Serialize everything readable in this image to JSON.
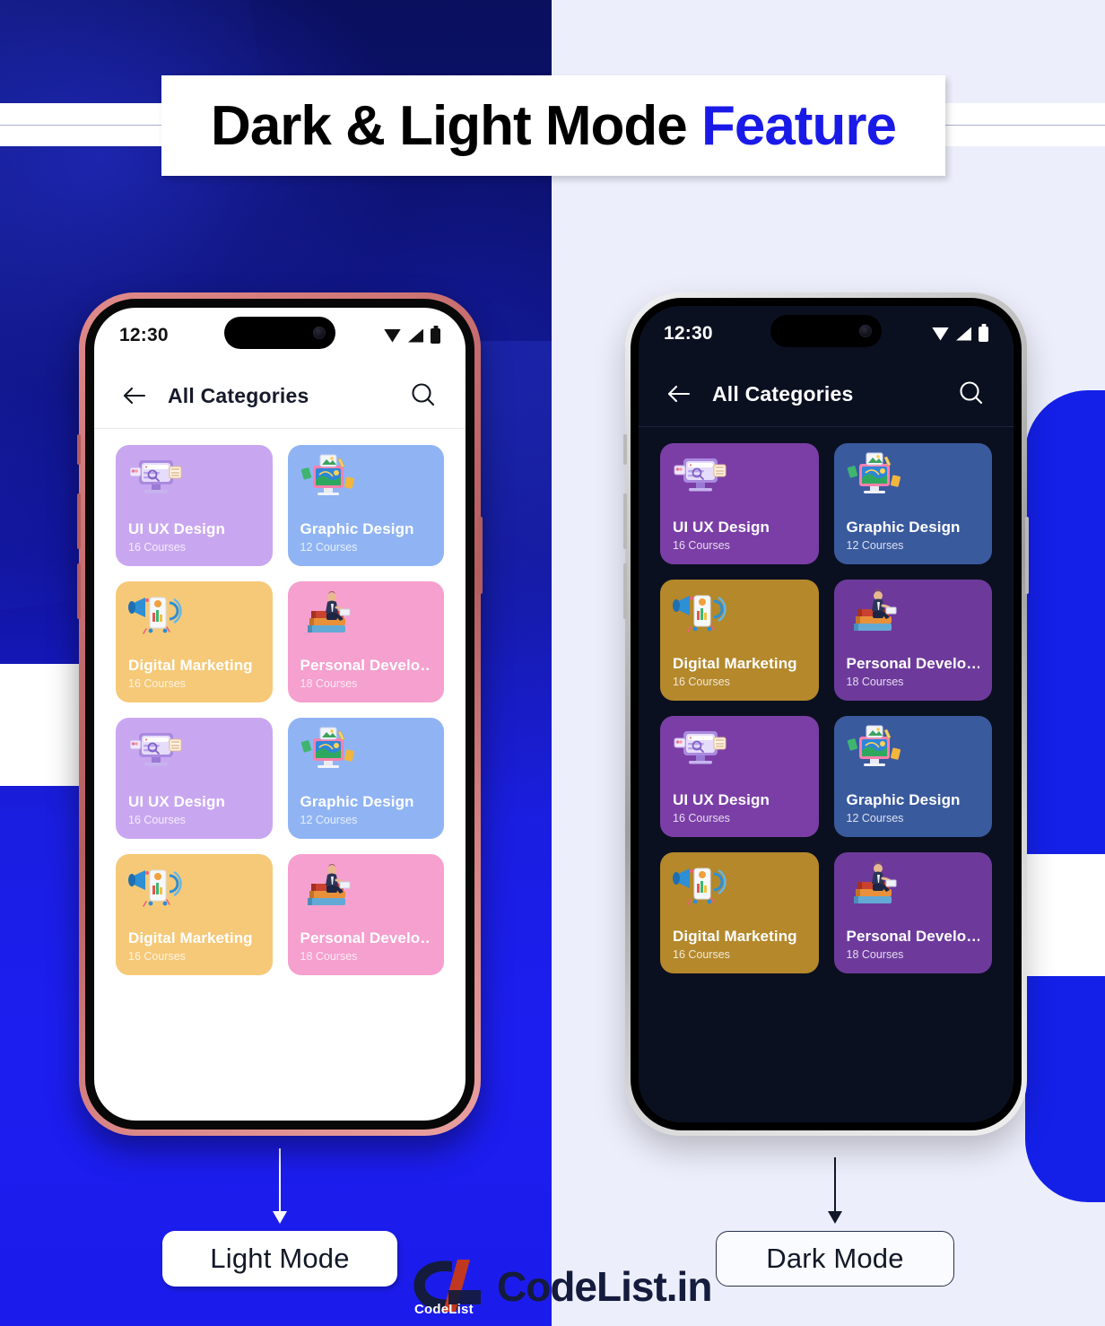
{
  "header": {
    "title_main": "Dark & Light Mode",
    "title_accent": "Feature"
  },
  "callouts": {
    "light_label": "Light Mode",
    "dark_label": "Dark Mode"
  },
  "watermark": {
    "brand": "CodeList.in",
    "logo_caption": "CodeList"
  },
  "colors": {
    "accent_blue": "#1a1ae8",
    "panel_blue": "#1420e8",
    "left_bg": "#10139a",
    "right_bg": "#eceefb",
    "light_screen_bg": "#ffffff",
    "dark_screen_bg": "#0b1020"
  },
  "light_phone": {
    "theme": "light",
    "status": {
      "time": "12:30",
      "icons": [
        "wifi-icon",
        "signal-icon",
        "battery-icon"
      ]
    },
    "appbar": {
      "back_icon": "back-arrow-icon",
      "title": "All Categories",
      "search_icon": "search-icon"
    },
    "cards": [
      {
        "title": "UI UX Design",
        "subtitle": "16 Courses",
        "color": "#c9a7f0",
        "illus": "ui-ux-monitor-illustration"
      },
      {
        "title": "Graphic Design",
        "subtitle": "12 Courses",
        "color": "#90b4f3",
        "illus": "graphic-design-monitor-illustration"
      },
      {
        "title": "Digital Marketing",
        "subtitle": "16 Courses",
        "color": "#f6c978",
        "illus": "megaphone-phone-illustration"
      },
      {
        "title": "Personal Develo…",
        "subtitle": "18 Courses",
        "color": "#f5a0ce",
        "illus": "person-on-books-illustration"
      },
      {
        "title": "UI UX Design",
        "subtitle": "16 Courses",
        "color": "#c9a7f0",
        "illus": "ui-ux-monitor-illustration"
      },
      {
        "title": "Graphic Design",
        "subtitle": "12 Courses",
        "color": "#90b4f3",
        "illus": "graphic-design-monitor-illustration"
      },
      {
        "title": "Digital Marketing",
        "subtitle": "16 Courses",
        "color": "#f6c978",
        "illus": "megaphone-phone-illustration"
      },
      {
        "title": "Personal Develo…",
        "subtitle": "18 Courses",
        "color": "#f5a0ce",
        "illus": "person-on-books-illustration"
      }
    ]
  },
  "dark_phone": {
    "theme": "dark",
    "status": {
      "time": "12:30",
      "icons": [
        "wifi-icon",
        "signal-icon",
        "battery-icon"
      ]
    },
    "appbar": {
      "back_icon": "back-arrow-icon",
      "title": "All Categories",
      "search_icon": "search-icon"
    },
    "cards": [
      {
        "title": "UI UX Design",
        "subtitle": "16 Courses",
        "color": "#7b3ea6",
        "illus": "ui-ux-monitor-illustration"
      },
      {
        "title": "Graphic Design",
        "subtitle": "12 Courses",
        "color": "#3a5a9e",
        "illus": "graphic-design-monitor-illustration"
      },
      {
        "title": "Digital Marketing",
        "subtitle": "16 Courses",
        "color": "#b4882b",
        "illus": "megaphone-phone-illustration"
      },
      {
        "title": "Personal Develo…",
        "subtitle": "18 Courses",
        "color": "#6d3a9c",
        "illus": "person-on-books-illustration"
      },
      {
        "title": "UI UX Design",
        "subtitle": "16 Courses",
        "color": "#7b3ea6",
        "illus": "ui-ux-monitor-illustration"
      },
      {
        "title": "Graphic Design",
        "subtitle": "12 Courses",
        "color": "#3a5a9e",
        "illus": "graphic-design-monitor-illustration"
      },
      {
        "title": "Digital Marketing",
        "subtitle": "16 Courses",
        "color": "#b4882b",
        "illus": "megaphone-phone-illustration"
      },
      {
        "title": "Personal Develo…",
        "subtitle": "18 Courses",
        "color": "#6d3a9c",
        "illus": "person-on-books-illustration"
      }
    ]
  }
}
